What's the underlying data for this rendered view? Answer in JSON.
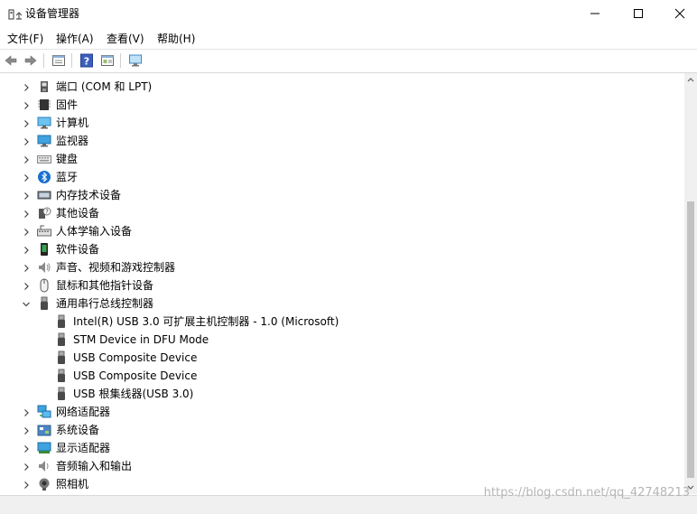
{
  "window": {
    "title": "设备管理器"
  },
  "menu": [
    "文件(F)",
    "操作(A)",
    "查看(V)",
    "帮助(H)"
  ],
  "toolbar": [
    "back-icon",
    "forward-icon",
    "properties-icon",
    "help-icon",
    "details-view-icon",
    "monitor-icon"
  ],
  "tree": [
    {
      "label": "端口 (COM 和 LPT)",
      "expanded": false,
      "icon": "port-icon"
    },
    {
      "label": "固件",
      "expanded": false,
      "icon": "firmware-icon"
    },
    {
      "label": "计算机",
      "expanded": false,
      "icon": "computer-icon"
    },
    {
      "label": "监视器",
      "expanded": false,
      "icon": "monitor-icon"
    },
    {
      "label": "键盘",
      "expanded": false,
      "icon": "keyboard-icon"
    },
    {
      "label": "蓝牙",
      "expanded": false,
      "icon": "bluetooth-icon"
    },
    {
      "label": "内存技术设备",
      "expanded": false,
      "icon": "memory-icon"
    },
    {
      "label": "其他设备",
      "expanded": false,
      "icon": "unknown-device-icon"
    },
    {
      "label": "人体学输入设备",
      "expanded": false,
      "icon": "hid-icon"
    },
    {
      "label": "软件设备",
      "expanded": false,
      "icon": "software-device-icon"
    },
    {
      "label": "声音、视频和游戏控制器",
      "expanded": false,
      "icon": "speaker-icon"
    },
    {
      "label": "鼠标和其他指针设备",
      "expanded": false,
      "icon": "mouse-icon"
    },
    {
      "label": "通用串行总线控制器",
      "expanded": true,
      "icon": "usb-icon",
      "children": [
        {
          "label": "Intel(R) USB 3.0 可扩展主机控制器 - 1.0 (Microsoft)",
          "icon": "usb-icon"
        },
        {
          "label": "STM Device in DFU Mode",
          "icon": "usb-icon"
        },
        {
          "label": "USB Composite Device",
          "icon": "usb-icon"
        },
        {
          "label": "USB Composite Device",
          "icon": "usb-icon"
        },
        {
          "label": "USB 根集线器(USB 3.0)",
          "icon": "usb-icon"
        }
      ]
    },
    {
      "label": "网络适配器",
      "expanded": false,
      "icon": "network-icon"
    },
    {
      "label": "系统设备",
      "expanded": false,
      "icon": "system-device-icon"
    },
    {
      "label": "显示适配器",
      "expanded": false,
      "icon": "display-adapter-icon"
    },
    {
      "label": "音频输入和输出",
      "expanded": false,
      "icon": "audio-icon"
    },
    {
      "label": "照相机",
      "expanded": false,
      "icon": "camera-icon"
    }
  ],
  "watermark": "https://blog.csdn.net/qq_42748213"
}
